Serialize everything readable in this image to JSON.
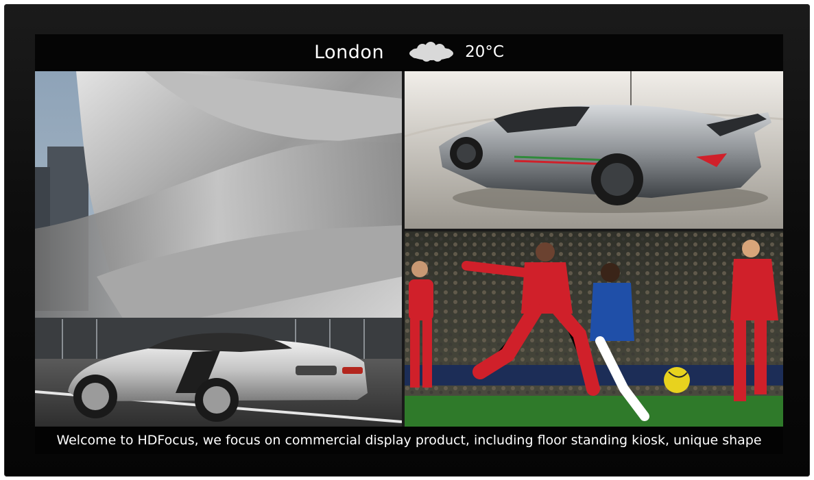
{
  "header": {
    "city": "London",
    "weather_icon": "cloud-icon",
    "temperature": "20°C"
  },
  "panels": {
    "left": {
      "subject": "building-with-silver-sports-car"
    },
    "top_right": {
      "subject": "silver-supercar"
    },
    "bottom_right": {
      "subject": "football-match"
    }
  },
  "ticker": {
    "text": "Welcome to HDFocus, we focus on commercial display product, including floor standing kiosk, unique shape"
  },
  "colors": {
    "bezel": "#0d0d0d",
    "bar_background": "#050505",
    "text": "#ffffff",
    "team_red": "#d0202a",
    "team_blue": "#1f4fa8",
    "pitch_green": "#2f7a2a"
  }
}
